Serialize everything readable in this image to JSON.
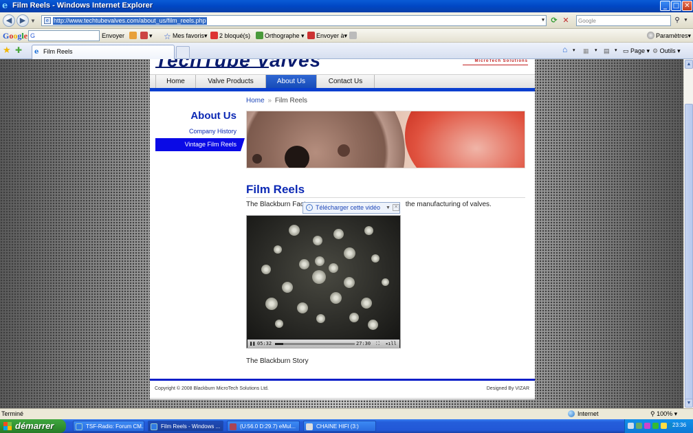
{
  "window": {
    "title": "Film Reels - Windows Internet Explorer",
    "controls": {
      "minimize": "_",
      "maximize": "□",
      "close": "✕"
    }
  },
  "address_bar": {
    "url": "http://www.techtubevalves.com/about_us/film_reels.php",
    "search_placeholder": "Google"
  },
  "google_toolbar": {
    "logo": [
      "G",
      "o",
      "o",
      "g",
      "l",
      "e"
    ],
    "search_value": "G",
    "items": {
      "send": "Envoyer",
      "favorites": "Mes favoris▾",
      "blocked": "2 bloqué(s)",
      "spelling": "Orthographe",
      "send_to": "Envoyer à▾",
      "settings": "Paramètres▾"
    }
  },
  "tabs": [
    {
      "label": "Film Reels"
    }
  ],
  "command_bar": {
    "page": "Page",
    "tools": "Outils"
  },
  "page": {
    "logo_text": "TechTube Valves",
    "logo_tagline": "MicroTech Solutions",
    "nav": [
      "Home",
      "Valve Products",
      "About Us",
      "Contact Us"
    ],
    "nav_active": "About Us",
    "sidebar": {
      "title": "About Us",
      "links": [
        "Company History",
        "Vintage Film Reels"
      ],
      "active": "Vintage Film Reels"
    },
    "breadcrumb": {
      "home": "Home",
      "separator": "»",
      "current": "Film Reels"
    },
    "article": {
      "title": "Film Reels",
      "text_start": "The Blackburn Fact",
      "text_end": "the manufacturing of valves."
    },
    "download_popup": {
      "label": "Télécharger cette vidéo"
    },
    "video": {
      "elapsed": "05:32",
      "total": "27:30",
      "progress": 0.1
    },
    "caption": "The Blackburn Story",
    "footer": {
      "copyright": "Copyright © 2008 Blackburn MicroTech Solutions Ltd.",
      "credit": "Designed By VIZAR"
    }
  },
  "status_bar": {
    "text": "Terminé",
    "zone": "Internet",
    "zoom": "100%"
  },
  "taskbar": {
    "start": "démarrer",
    "tasks": [
      {
        "label": "TSF-Radio: Forum CM..."
      },
      {
        "label": "Film Reels - Windows ..."
      },
      {
        "label": "(U:56.0 D:29.7) eMul..."
      },
      {
        "label": "CHAINE HIFI (3:)"
      }
    ],
    "active_task": "Film Reels - Windows ...",
    "clock": "23:36"
  },
  "colors": {
    "accent": "#0b28b4",
    "nav_active": "#2f67d3",
    "brand_red": "#c01d1d"
  },
  "icons": [
    "ie-icon",
    "back-arrow-icon",
    "forward-arrow-icon",
    "refresh-icon",
    "stop-icon",
    "search-icon",
    "star-icon",
    "add-favorite-icon",
    "home-icon",
    "feed-icon",
    "print-icon",
    "gear-icon",
    "globe-icon",
    "download-icon",
    "close-icon",
    "play-pause-icon",
    "fullscreen-icon",
    "volume-icon",
    "windows-flag-icon"
  ]
}
